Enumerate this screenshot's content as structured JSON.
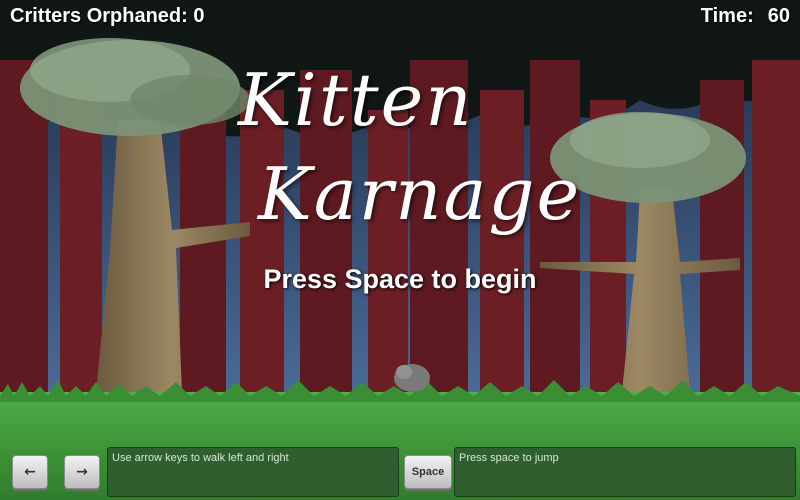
{
  "hud": {
    "critters_orphaned": "Critters Orphaned: 0",
    "time_label": "Time:",
    "time_value": "60"
  },
  "title": {
    "line1": "Kitten",
    "line2": "Karnage"
  },
  "prompt": "Press Space to begin",
  "controls": {
    "left_key": "←",
    "right_key": "→",
    "walk_hint": "Use arrow keys to walk left and right",
    "space_key": "Space",
    "jump_hint": "Press space to jump"
  },
  "colors": {
    "sky": "#3d5a85",
    "trunk": "#6b1f24",
    "grass": "#3f9a3a",
    "canopy": "#7c9376",
    "tree_bark": "#8e7a5a"
  }
}
